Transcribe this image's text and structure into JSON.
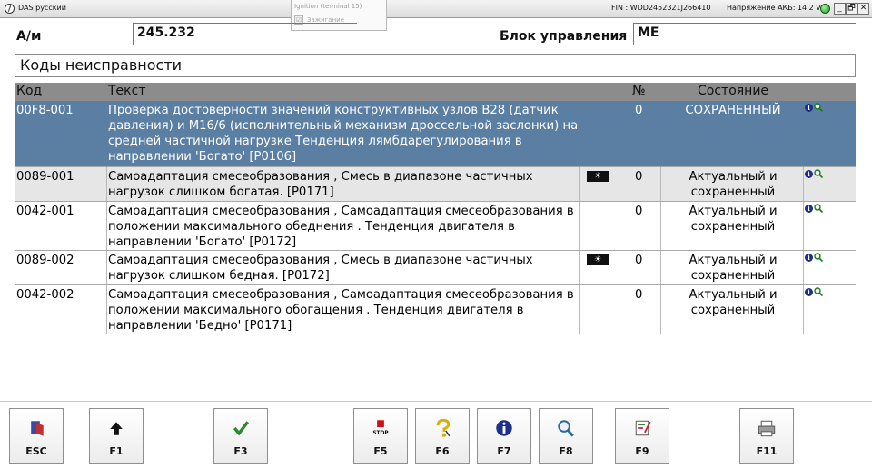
{
  "window": {
    "title": "DAS русский",
    "fin": "FIN : WDD2452321J266410",
    "battery": "Напряжение АКБ: 14.2 V",
    "min_label": "_",
    "max_label": "🗗",
    "close_label": "✕"
  },
  "ignition": {
    "label": "Ignition (terminal 15)",
    "checkbox_label": "Зажигание",
    "check_mark": "☑"
  },
  "header": {
    "am_label": "А/м",
    "am_value": "245.232",
    "ecu_label": "Блок управления",
    "ecu_value": "ME"
  },
  "section_title": "Коды неисправности",
  "table": {
    "columns": [
      "Код",
      "Текст",
      "№",
      "Состояние"
    ],
    "rows": [
      {
        "code": "00F8-001",
        "text": "Проверка достоверности значений конструктивных узлов B28 (датчик давления) и M16/6 (исполнительный механизм дроссельной заслонки) на средней частичной нагрузке Тенденция лямбдарегулирования в направлении 'Богато' [P0106]",
        "num": "0",
        "state": "СОХРАНЕННЫЙ",
        "freeze": false
      },
      {
        "code": "0089-001",
        "text": "Самоадаптация смесеобразования , Смесь в диапазоне частичных нагрузок слишком богатая. [P0171]",
        "num": "0",
        "state": "Актуальный и сохраненный",
        "freeze": true
      },
      {
        "code": "0042-001",
        "text": "Самоадаптация смесеобразования , Самоадаптация смесеобразования в положении максимального обеднения . Тенденция двигателя в направлении 'Богато' [P0172]",
        "num": "0",
        "state": "Актуальный и сохраненный",
        "freeze": false
      },
      {
        "code": "0089-002",
        "text": "Самоадаптация смесеобразования , Смесь в диапазоне частичных нагрузок слишком бедная. [P0172]",
        "num": "0",
        "state": "Актуальный и сохраненный",
        "freeze": true
      },
      {
        "code": "0042-002",
        "text": "Самоадаптация смесеобразования , Самоадаптация смесеобразования в положении максимального обогащения . Тенденция двигателя в направлении 'Бедно' [P0171]",
        "num": "0",
        "state": "Актуальный и сохраненный",
        "freeze": false
      }
    ]
  },
  "icons": {
    "freeze_frame": "☀",
    "info": "i"
  },
  "toolbar": {
    "esc": "ESC",
    "f1": "F1",
    "f3": "F3",
    "f5": "F5",
    "f5_stop": "STOP",
    "f6": "F6",
    "f7": "F7",
    "f8": "F8",
    "f9": "F9",
    "f11": "F11"
  },
  "colors": {
    "selected_row": "#5b7fa3",
    "header_bar": "#8c8c8c",
    "alt_row": "#e6e6e6"
  }
}
